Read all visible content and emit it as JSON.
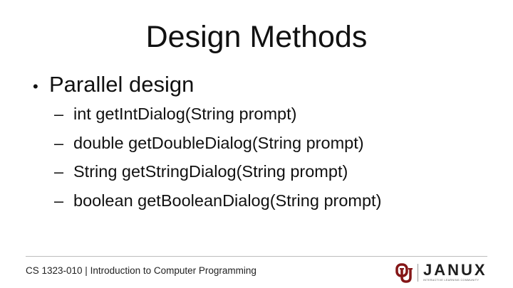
{
  "slide": {
    "title": "Design Methods",
    "bullet": "Parallel design",
    "bullet_marker": "•",
    "sub_marker": "–",
    "sub_items": [
      "int getIntDialog(String prompt)",
      "double getDoubleDialog(String prompt)",
      "String getStringDialog(String prompt)",
      "boolean getBooleanDialog(String prompt)"
    ]
  },
  "footer": {
    "course_text": "CS 1323-010 | Introduction to Computer Programming",
    "brand": "JANUX",
    "tagline": "INTERACTIVE LEARNING COMMUNITY"
  },
  "colors": {
    "ou_crimson": "#841617",
    "text": "#111111"
  },
  "icons": {
    "ou_logo": "ou-interlocking-logo-icon"
  }
}
